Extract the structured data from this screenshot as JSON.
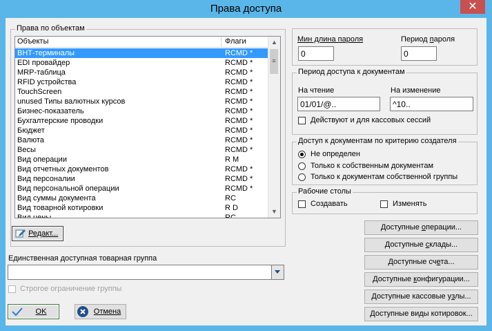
{
  "window": {
    "title": "Права доступа",
    "close_glyph": "✕"
  },
  "objects_group": {
    "legend": "Права по объектам",
    "columns": {
      "object": "Объекты",
      "flags": "Флаги"
    },
    "rows": [
      {
        "name": "ВНТ-терминалы",
        "flags": "RCMD *"
      },
      {
        "name": "EDI провайдер",
        "flags": "RCMD *"
      },
      {
        "name": "MRP-таблица",
        "flags": "RCMD *"
      },
      {
        "name": "RFID устройства",
        "flags": "RCMD *"
      },
      {
        "name": "TouchScreen",
        "flags": "RCMD *"
      },
      {
        "name": "unused Типы валютных курсов",
        "flags": "RCMD *"
      },
      {
        "name": "Бизнес-показатель",
        "flags": "RCMD *"
      },
      {
        "name": "Бухгалтерские проводки",
        "flags": "RCMD *"
      },
      {
        "name": "Бюджет",
        "flags": "RCMD *"
      },
      {
        "name": "Валюта",
        "flags": "RCMD *"
      },
      {
        "name": "Весы",
        "flags": "RCMD *"
      },
      {
        "name": "Вид операции",
        "flags": "R M"
      },
      {
        "name": "Вид отчетных документов",
        "flags": "RCMD *"
      },
      {
        "name": "Вид персоналии",
        "flags": "RCMD *"
      },
      {
        "name": "Вид персональной операции",
        "flags": "RCMD *"
      },
      {
        "name": "Вид суммы документа",
        "flags": "RC"
      },
      {
        "name": "Вид товарной котировки",
        "flags": "R  D"
      },
      {
        "name": "Вид цены",
        "flags": "RC"
      }
    ],
    "edit_button": "Редакт..."
  },
  "password": {
    "min_len_label": "Мин длина пароля",
    "min_len_value": "0",
    "period_label_pre": "Период ",
    "period_label_u": "п",
    "period_label_post": "ароля",
    "period_value": "0"
  },
  "doc_access": {
    "legend": "Период доступа к документам",
    "read_label": "На чтение",
    "read_value": "01/01/@..",
    "change_label": "На изменение",
    "change_value": "^10..",
    "cash_sessions_label": "Действуют и для кассовых сессий"
  },
  "creator_access": {
    "legend": "Доступ к документам по критерию создателя",
    "options": [
      "Не определен",
      "Только к собственным документам",
      "Только к документам собственной группы"
    ]
  },
  "desktops": {
    "legend": "Рабочие столы",
    "create_label": "Создавать",
    "change_label": "Изменять"
  },
  "side_buttons": [
    {
      "pre": "Доступные ",
      "u": "о",
      "post": "перации..."
    },
    {
      "pre": "Доступные ",
      "u": "с",
      "post": "клады..."
    },
    {
      "pre": "Доступные сч",
      "u": "е",
      "post": "та..."
    },
    {
      "pre": "Доступные ",
      "u": "к",
      "post": "онфигурации..."
    },
    {
      "pre": "Доступные кассовые у",
      "u": "з",
      "post": "лы..."
    },
    {
      "pre": "Доступные виды котировок...",
      "u": "",
      "post": ""
    }
  ],
  "goods_group": {
    "label": "Единственная доступная товарная группа",
    "value": "",
    "strict_label": "Строгое ограничение группы"
  },
  "ok_button": "OK",
  "cancel_button": "Отмена"
}
